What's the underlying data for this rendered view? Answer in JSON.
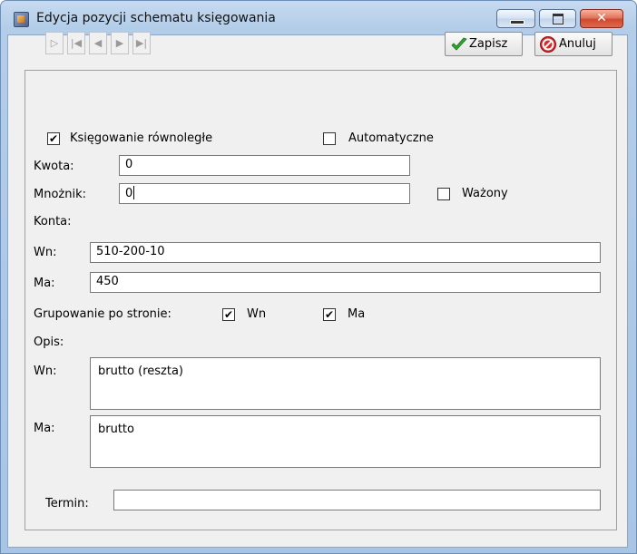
{
  "window": {
    "title": "Edycja pozycji schematu księgowania",
    "close_glyph": "✕"
  },
  "toolbar": {
    "nav_buttons": [
      "▷",
      "|◀",
      "◀",
      "▶",
      "▶|"
    ],
    "save_label": "Zapisz",
    "save_icon": "check-icon",
    "cancel_label": "Anuluj",
    "cancel_icon": "cancel-icon"
  },
  "form": {
    "ksiegowanie_rownolegle": {
      "label": "Księgowanie równoległe",
      "checked": true
    },
    "automatyczne": {
      "label": "Automatyczne",
      "checked": false
    },
    "kwota": {
      "label": "Kwota:",
      "value": "0"
    },
    "mnoznik": {
      "label": "Mnożnik:",
      "value": "0"
    },
    "wazony": {
      "label": "Ważony",
      "checked": false
    },
    "konta_label": "Konta:",
    "konta_wn": {
      "label": "Wn:",
      "value": "510-200-10"
    },
    "konta_ma": {
      "label": "Ma:",
      "value": "450"
    },
    "grupowanie": {
      "label": "Grupowanie po stronie:",
      "wn": {
        "label": "Wn",
        "checked": true
      },
      "ma": {
        "label": "Ma",
        "checked": true
      }
    },
    "opis_label": "Opis:",
    "opis_wn": {
      "label": "Wn:",
      "value": "brutto (reszta)"
    },
    "opis_ma": {
      "label": "Ma:",
      "value": "brutto"
    },
    "termin": {
      "label": "Termin:",
      "value": ""
    }
  },
  "colors": {
    "accept_green": "#2fa82f",
    "cancel_red": "#d8262b"
  }
}
